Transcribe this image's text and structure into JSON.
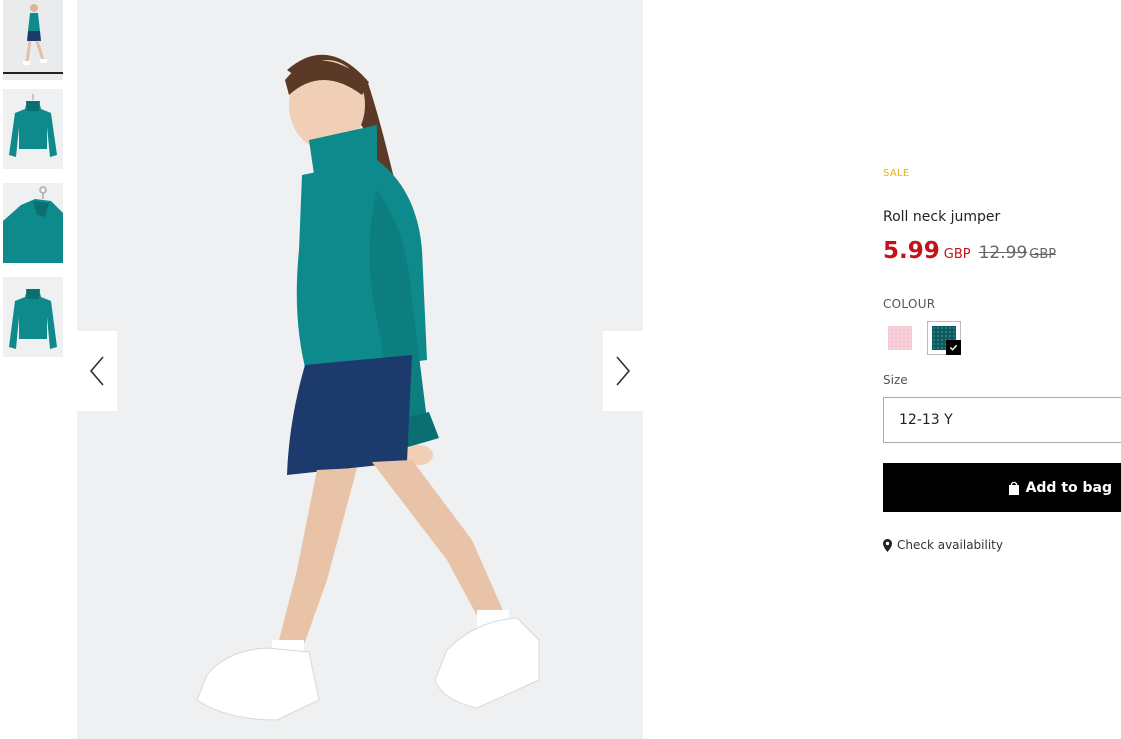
{
  "product": {
    "badge": "SALE",
    "name": "Roll neck jumper",
    "price": {
      "current": "5.99",
      "current_currency": "GBP",
      "old": "12.99",
      "old_currency": "GBP"
    },
    "colour_label": "COLOUR",
    "swatches": [
      {
        "name": "pink",
        "color": "#f4c9d3",
        "selected": false
      },
      {
        "name": "teal",
        "color": "#0f5a5e",
        "selected": true
      }
    ],
    "size_label": "Size",
    "size_value": "12-13 Y",
    "add_to_bag": "Add to bag",
    "check_availability": "Check availability"
  },
  "gallery": {
    "thumbnails": [
      "thumb-model",
      "thumb-front",
      "thumb-hanger",
      "thumb-back"
    ],
    "active_thumbnail": 0,
    "colors": {
      "sweater": "#0f8a8c",
      "skirt": "#1c3a6b",
      "background": "#eef0f1"
    }
  },
  "icons": [
    "chevron-left-icon",
    "chevron-right-icon",
    "bag-icon",
    "location-pin-icon",
    "check-icon"
  ]
}
